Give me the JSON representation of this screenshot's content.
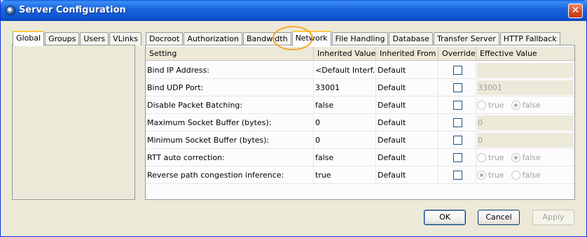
{
  "window": {
    "title": "Server Configuration",
    "close_glyph": "✕"
  },
  "left_tabs": [
    "Global",
    "Groups",
    "Users",
    "VLinks"
  ],
  "right_tabs": [
    "Docroot",
    "Authorization",
    "Bandwidth",
    "Network",
    "File Handling",
    "Database",
    "Transfer Server",
    "HTTP Fallback"
  ],
  "active_right_tab": "Network",
  "table": {
    "headers": [
      "Setting",
      "Inherited Value",
      "Inherited From",
      "Override",
      "Effective Value"
    ],
    "rows": [
      {
        "setting": "Bind IP Address:",
        "inherited_value": "<Default Interf...",
        "inherited_from": "Default",
        "override": false,
        "effective_kind": "field",
        "effective_value": ""
      },
      {
        "setting": "Bind UDP Port:",
        "inherited_value": "33001",
        "inherited_from": "Default",
        "override": false,
        "effective_kind": "field",
        "effective_value": "33001"
      },
      {
        "setting": "Disable Packet Batching:",
        "inherited_value": "false",
        "inherited_from": "Default",
        "override": false,
        "effective_kind": "radio",
        "radio_true": "true",
        "radio_false": "false",
        "selected": "false"
      },
      {
        "setting": "Maximum Socket Buffer (bytes):",
        "inherited_value": "0",
        "inherited_from": "Default",
        "override": false,
        "effective_kind": "field",
        "effective_value": "0"
      },
      {
        "setting": "Minimum Socket Buffer (bytes):",
        "inherited_value": "0",
        "inherited_from": "Default",
        "override": false,
        "effective_kind": "field",
        "effective_value": "0"
      },
      {
        "setting": "RTT auto correction:",
        "inherited_value": "false",
        "inherited_from": "Default",
        "override": false,
        "effective_kind": "radio",
        "radio_true": "true",
        "radio_false": "false",
        "selected": "false"
      },
      {
        "setting": "Reverse path congestion inference:",
        "inherited_value": "true",
        "inherited_from": "Default",
        "override": false,
        "effective_kind": "radio",
        "radio_true": "true",
        "radio_false": "false",
        "selected": "true"
      }
    ]
  },
  "buttons": {
    "ok": "OK",
    "cancel": "Cancel",
    "apply": "Apply"
  },
  "colors": {
    "title_bar": "#0d54d0",
    "highlight_ring": "#f5a623",
    "tab_active_accent": "#ffc83c"
  }
}
